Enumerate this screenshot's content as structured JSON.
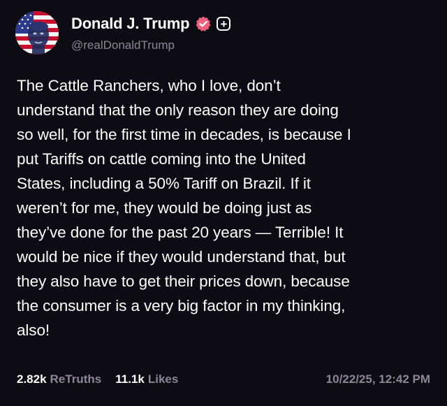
{
  "author": {
    "display_name": "Donald J. Trump",
    "handle": "@realDonaldTrump",
    "verified_icon": "verified-badge-icon",
    "plus_icon": "plus-badge-icon",
    "plus_symbol": "+"
  },
  "post": {
    "lines": [
      "The Cattle Ranchers, who I love, don’t",
      "understand that the only reason they are doing",
      "so well, for the first time in decades, is because I",
      "put Tariffs on cattle coming into the United",
      "States, including a 50% Tariff on Brazil. If it",
      "weren’t for me, they would be doing just as",
      "they’ve done for the past 20 years — Terrible! It",
      "would be nice if they would understand that, but",
      "they also have to get their prices down, because",
      "the consumer is a very big factor in my thinking,",
      "also!"
    ]
  },
  "stats": {
    "retruths_count": "2.82k",
    "retruths_label": "ReTruths",
    "likes_count": "11.1k",
    "likes_label": "Likes"
  },
  "timestamp": "10/22/25, 12:42 PM",
  "colors": {
    "background": "#0d0b14",
    "text": "#ffffff",
    "muted": "#8b8795",
    "verified_badge": "#f0607a"
  }
}
